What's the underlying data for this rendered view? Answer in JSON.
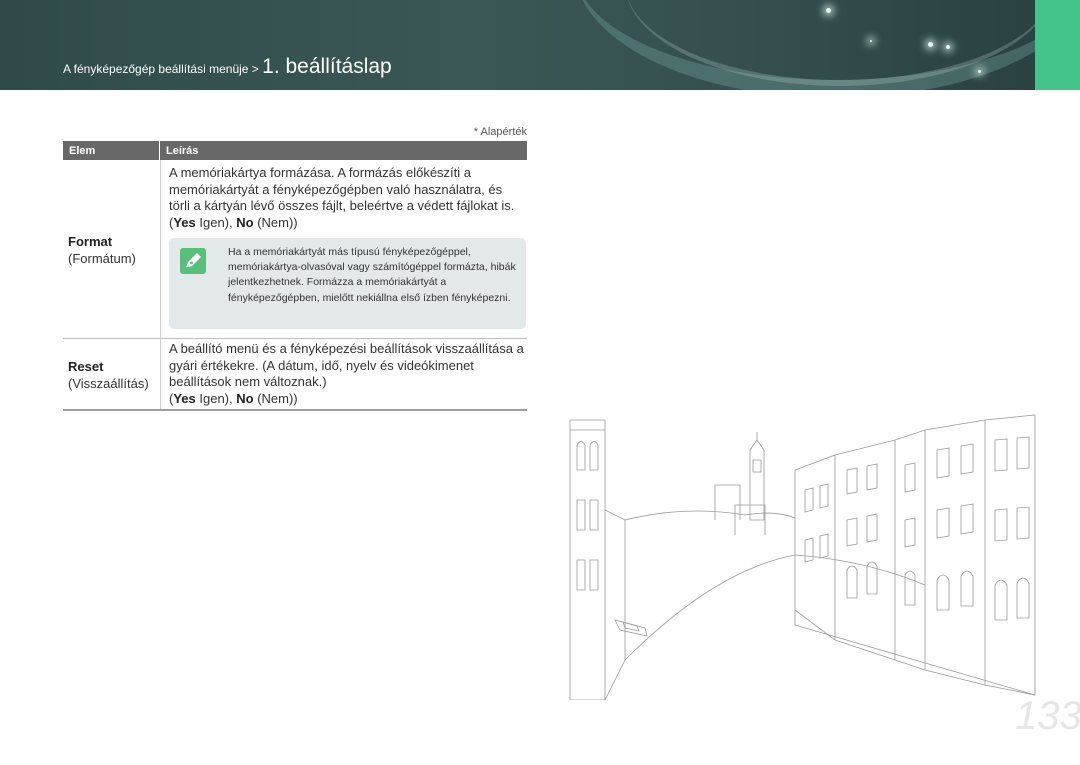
{
  "header": {
    "breadcrumb_prefix": "A fényképezőgép beállítási menüje > ",
    "breadcrumb_current": "1. beállításlap"
  },
  "default_note": "* Alapérték",
  "table": {
    "headers": {
      "item": "Elem",
      "description": "Leírás"
    },
    "rows": [
      {
        "name_en": "Format",
        "name_local": "(Formátum)",
        "desc_text": "A memóriakártya formázása. A formázás előkészíti a memóriakártyát a fényképezőgépben való használatra, és törli a kártyán lévő összes fájlt, beleértve a védett fájlokat is. (",
        "yes": "Yes",
        "yes_local": " Igen), ",
        "no": "No",
        "no_local": " (Nem))",
        "note": "Ha a memóriakártyát más típusú fényképezőgéppel, memóriakártya-olvasóval vagy számítógéppel formázta, hibák jelentkezhetnek. Formázza a memóriakártyát a fényképezőgépben, mielőtt nekiállna első ízben fényképezni."
      },
      {
        "name_en": "Reset",
        "name_local": "(Visszaállítás)",
        "desc_text": "A beállító menü és a fényképezési beállítások visszaállítása a gyári értékekre. (A dátum, idő, nyelv és videókimenet beállítások nem változnak.)",
        "yes_prefix": "(",
        "yes": "Yes",
        "yes_local": " Igen), ",
        "no": "No",
        "no_local": " (Nem))"
      }
    ]
  },
  "page_number": "133",
  "colors": {
    "accent_green": "#44c48a",
    "header_teal": "#3a5756",
    "table_header": "#686868"
  }
}
